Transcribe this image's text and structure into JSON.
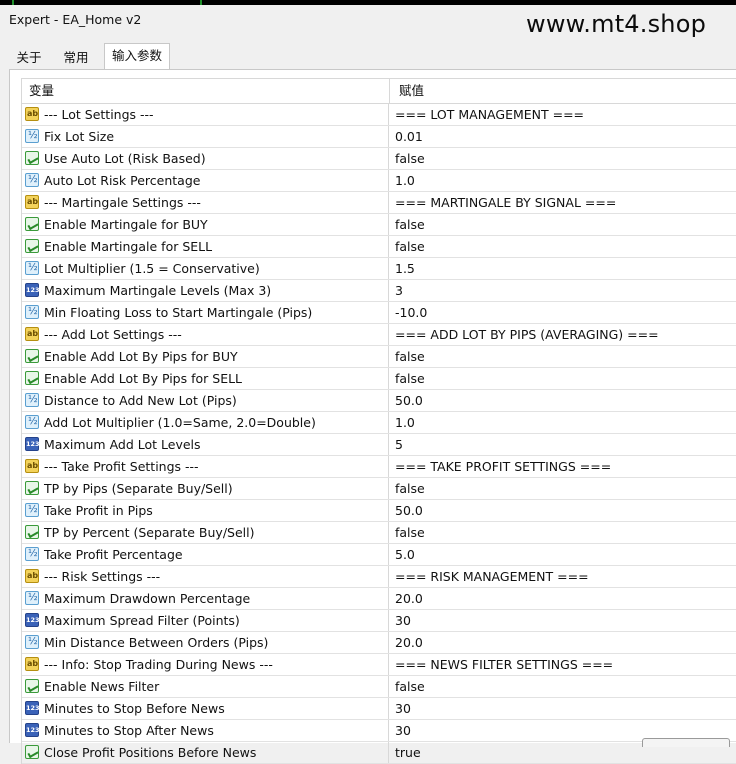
{
  "window": {
    "title": "Expert - EA_Home v2"
  },
  "watermark": "www.mt4.shop",
  "tabs": [
    {
      "label": "关于"
    },
    {
      "label": "常用"
    },
    {
      "label": "输入参数",
      "active": true
    }
  ],
  "table": {
    "headers": {
      "variable": "变量",
      "value": "赋值"
    },
    "rows": [
      {
        "icon": "string-icon",
        "name": "--- Lot Settings ---",
        "value": "=== LOT MANAGEMENT ==="
      },
      {
        "icon": "double-icon",
        "name": "Fix Lot Size",
        "value": "0.01"
      },
      {
        "icon": "bool-icon",
        "name": "Use Auto Lot (Risk Based)",
        "value": "false"
      },
      {
        "icon": "double-icon",
        "name": "Auto Lot Risk Percentage",
        "value": "1.0"
      },
      {
        "icon": "string-icon",
        "name": "--- Martingale Settings ---",
        "value": "=== MARTINGALE BY SIGNAL ==="
      },
      {
        "icon": "bool-icon",
        "name": "Enable Martingale for BUY",
        "value": "false"
      },
      {
        "icon": "bool-icon",
        "name": "Enable Martingale for SELL",
        "value": "false"
      },
      {
        "icon": "double-icon",
        "name": "Lot Multiplier (1.5 = Conservative)",
        "value": "1.5"
      },
      {
        "icon": "int-icon",
        "name": "Maximum Martingale Levels (Max 3)",
        "value": "3"
      },
      {
        "icon": "double-icon",
        "name": "Min Floating Loss to Start Martingale (Pips)",
        "value": "-10.0"
      },
      {
        "icon": "string-icon",
        "name": "--- Add Lot Settings ---",
        "value": "=== ADD LOT BY PIPS (AVERAGING) ==="
      },
      {
        "icon": "bool-icon",
        "name": "Enable Add Lot By Pips for BUY",
        "value": "false"
      },
      {
        "icon": "bool-icon",
        "name": "Enable Add Lot By Pips for SELL",
        "value": "false"
      },
      {
        "icon": "double-icon",
        "name": "Distance to Add New Lot (Pips)",
        "value": "50.0"
      },
      {
        "icon": "double-icon",
        "name": "Add Lot Multiplier (1.0=Same, 2.0=Double)",
        "value": "1.0"
      },
      {
        "icon": "int-icon",
        "name": "Maximum Add Lot Levels",
        "value": "5"
      },
      {
        "icon": "string-icon",
        "name": "--- Take Profit Settings ---",
        "value": "=== TAKE PROFIT SETTINGS ==="
      },
      {
        "icon": "bool-icon",
        "name": "TP by Pips (Separate Buy/Sell)",
        "value": "false"
      },
      {
        "icon": "double-icon",
        "name": "Take Profit in Pips",
        "value": "50.0"
      },
      {
        "icon": "bool-icon",
        "name": "TP by Percent (Separate Buy/Sell)",
        "value": "false"
      },
      {
        "icon": "double-icon",
        "name": "Take Profit Percentage",
        "value": "5.0"
      },
      {
        "icon": "string-icon",
        "name": "--- Risk Settings ---",
        "value": "=== RISK MANAGEMENT ==="
      },
      {
        "icon": "double-icon",
        "name": "Maximum Drawdown Percentage",
        "value": "20.0"
      },
      {
        "icon": "int-icon",
        "name": "Maximum Spread Filter (Points)",
        "value": "30"
      },
      {
        "icon": "double-icon",
        "name": "Min Distance Between Orders (Pips)",
        "value": "20.0"
      },
      {
        "icon": "string-icon",
        "name": "--- Info: Stop Trading During News ---",
        "value": "=== NEWS FILTER SETTINGS ==="
      },
      {
        "icon": "bool-icon",
        "name": "Enable News Filter",
        "value": "false"
      },
      {
        "icon": "int-icon",
        "name": "Minutes to Stop Before News",
        "value": "30"
      },
      {
        "icon": "int-icon",
        "name": "Minutes to Stop After News",
        "value": "30"
      },
      {
        "icon": "bool-icon",
        "name": "Close Profit Positions Before News",
        "value": "true"
      }
    ]
  }
}
